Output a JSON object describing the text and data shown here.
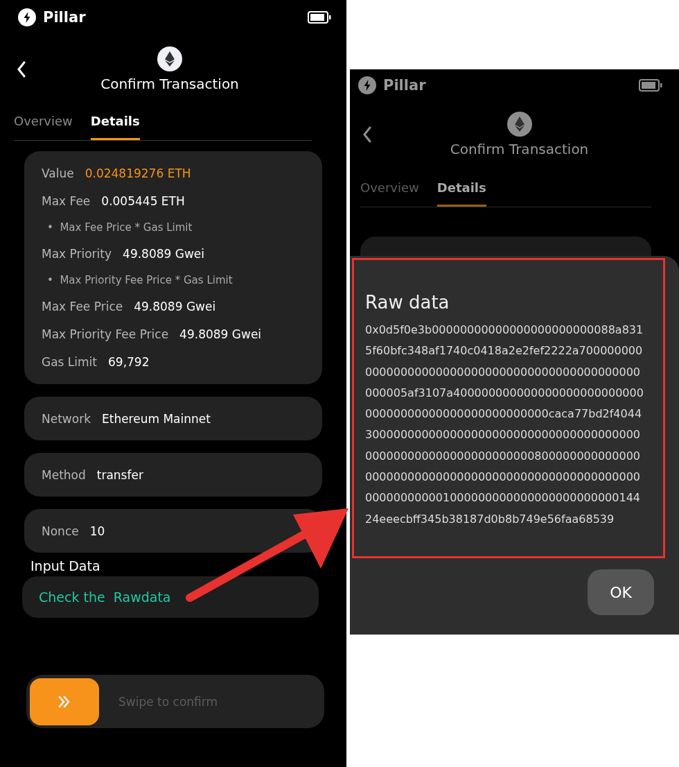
{
  "left_screen": {
    "status_bar": {
      "app_name": "Pillar"
    },
    "header": {
      "title": "Confirm Transaction"
    },
    "tabs": [
      {
        "label": "Overview",
        "selected": false
      },
      {
        "label": "Details",
        "selected": true
      }
    ],
    "fee_card": {
      "rows": [
        {
          "kind": "field",
          "label": "Value",
          "value": "0.024819276 ETH",
          "highlight": true
        },
        {
          "kind": "field",
          "label": "Max Fee",
          "value": "0.005445 ETH",
          "highlight": false
        },
        {
          "kind": "note",
          "text": "•  Max Fee Price * Gas Limit"
        },
        {
          "kind": "field",
          "label": "Max Priority",
          "value": "49.8089 Gwei",
          "highlight": false
        },
        {
          "kind": "note",
          "text": "•  Max Priority Fee Price * Gas Limit"
        },
        {
          "kind": "field",
          "label": "Max Fee Price",
          "value": "49.8089 Gwei",
          "highlight": false
        },
        {
          "kind": "field",
          "label": "Max Priority Fee Price",
          "value": "49.8089 Gwei",
          "highlight": false
        },
        {
          "kind": "field",
          "label": "Gas Limit",
          "value": "69,792",
          "highlight": false
        }
      ]
    },
    "info_cards": [
      {
        "label": "Network",
        "value": "Ethereum Mainnet"
      },
      {
        "label": "Method",
        "value": "transfer"
      },
      {
        "label": "Nonce",
        "value": "10"
      }
    ],
    "input_data": {
      "label": "Input Data",
      "link": "Check the  Rawdata"
    },
    "swipe": {
      "label": "Swipe to confirm",
      "level": 0
    }
  },
  "right_screen": {
    "status_bar": {
      "app_name": "Pillar"
    },
    "header": {
      "title": "Confirm Transaction"
    },
    "tabs": [
      {
        "label": "Overview",
        "selected": false
      },
      {
        "label": "Details",
        "selected": true
      }
    ],
    "dialog": {
      "title": "Raw data",
      "raw_data": "0x0d5f0e3b00000000000000000000000088a8315f60bfc348af1740c0418a2e2fef2222a700000000000000000000000000000000000000000000000000005af3107a40000000000000000000000000000000000000000000000000000caca77bd2f404430000000000000000000000000000000000000000000000000000000000000080000000000000000000000000000000000000000000000000000000000000000100000000000000000000000014424eeecbff345b38187d0b8b749e56faa68539",
      "button": "OK"
    }
  }
}
